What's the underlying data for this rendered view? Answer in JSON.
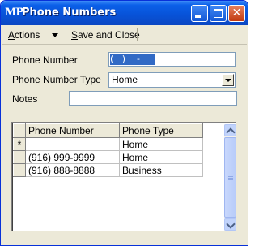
{
  "window": {
    "app_icon": "MP",
    "title": "Phone Numbers",
    "buttons": [
      "minimize-icon",
      "maximize-icon",
      "close-icon"
    ],
    "accent": "#0a5fe8"
  },
  "toolbar": {
    "actions_label_u": "A",
    "actions_label_rest": "ctions",
    "save_label_u": "S",
    "save_label_rest": "ave and Close"
  },
  "form": {
    "phone_number_label": "Phone Number",
    "phone_number_value": "(   )    -",
    "phone_number_type_label": "Phone Number Type",
    "phone_number_type_value": "Home",
    "notes_label": "Notes",
    "notes_value": ""
  },
  "grid": {
    "columns": [
      "Phone Number",
      "Phone Type"
    ],
    "rows": [
      {
        "marker": "*",
        "phone_number": "",
        "phone_type": "Home"
      },
      {
        "marker": "",
        "phone_number": "(916) 999-9999",
        "phone_type": "Home"
      },
      {
        "marker": "",
        "phone_number": "(916) 888-8888",
        "phone_type": "Business"
      }
    ]
  }
}
